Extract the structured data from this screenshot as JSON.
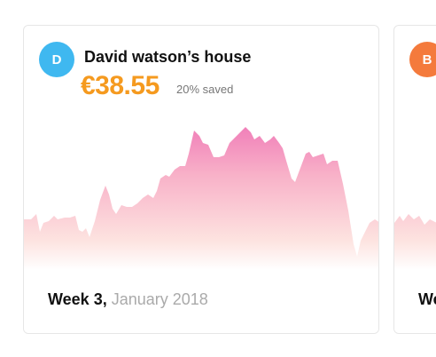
{
  "cards": [
    {
      "avatar_letter": "D",
      "house_name": "David watson’s house",
      "amount": "€38.55",
      "saved": "20% saved",
      "week_label": "Week 3,",
      "month_label": "January 2018",
      "colors": {
        "avatar": "#3fb8f0",
        "amount": "#f59a1f",
        "chart_top": "#f28bbe",
        "chart_bottom": "#ffe9e0"
      }
    },
    {
      "avatar_letter": "B",
      "week_label": "We",
      "colors": {
        "avatar": "#f47a3c"
      }
    }
  ]
}
